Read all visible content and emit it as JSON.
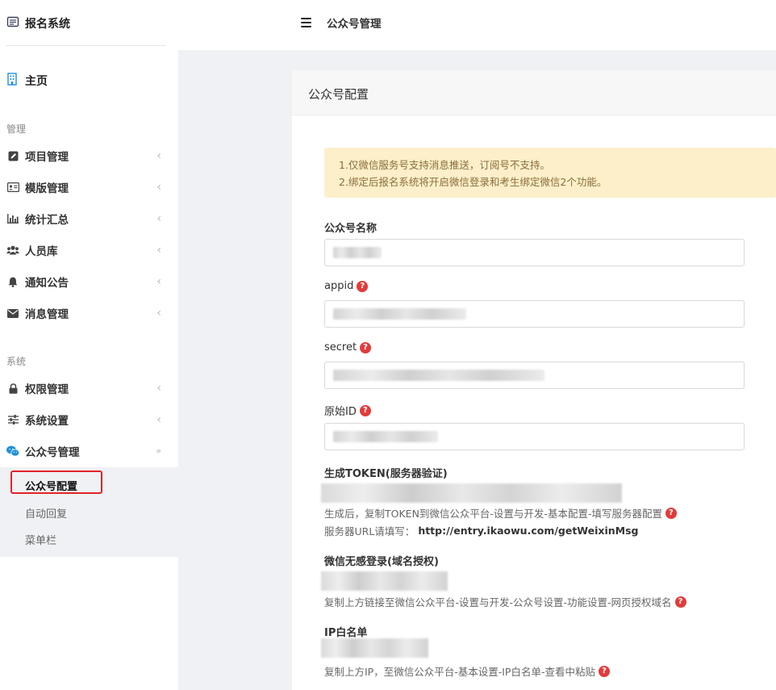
{
  "sidebar": {
    "brand": "报名系统",
    "home": "主页",
    "section_manage": "管理",
    "section_system": "系统",
    "manage_items": [
      {
        "label": "项目管理",
        "icon": "edit-icon"
      },
      {
        "label": "模版管理",
        "icon": "id-card-icon"
      },
      {
        "label": "统计汇总",
        "icon": "bar-chart-icon"
      },
      {
        "label": "人员库",
        "icon": "users-icon"
      },
      {
        "label": "通知公告",
        "icon": "bell-icon"
      },
      {
        "label": "消息管理",
        "icon": "envelope-icon"
      }
    ],
    "system_items": [
      {
        "label": "权限管理",
        "icon": "lock-icon"
      },
      {
        "label": "系统设置",
        "icon": "sliders-icon"
      },
      {
        "label": "公众号管理",
        "icon": "wechat-icon"
      }
    ],
    "submenu": [
      "公众号配置",
      "自动回复",
      "菜单栏"
    ]
  },
  "topbar": {
    "title": "公众号管理"
  },
  "card": {
    "title": "公众号配置"
  },
  "notice": {
    "line1": "1.仅微信服务号支持消息推送，订阅号不支持。",
    "line2": "2.绑定后报名系统将开启微信登录和考生绑定微信2个功能。"
  },
  "form": {
    "name_label": "公众号名称",
    "appid_label": "appid",
    "secret_label": "secret",
    "origid_label": "原始ID",
    "token_label": "生成TOKEN(服务器验证)",
    "token_hint": "生成后，复制TOKEN到微信公众平台-设置与开发-基本配置-填写服务器配置",
    "server_url_prefix": "服务器URL请填写：",
    "server_url": "http://entry.ikaowu.com/getWeixinMsg",
    "domain_label": "微信无感登录(域名授权)",
    "domain_hint": "复制上方链接至微信公众平台-设置与开发-公众号设置-功能设置-网页授权域名",
    "ip_label": "IP白名单",
    "ip_hint": "复制上方IP，至微信公众平台-基本设置-IP白名单-查看中粘贴",
    "help_glyph": "?"
  }
}
